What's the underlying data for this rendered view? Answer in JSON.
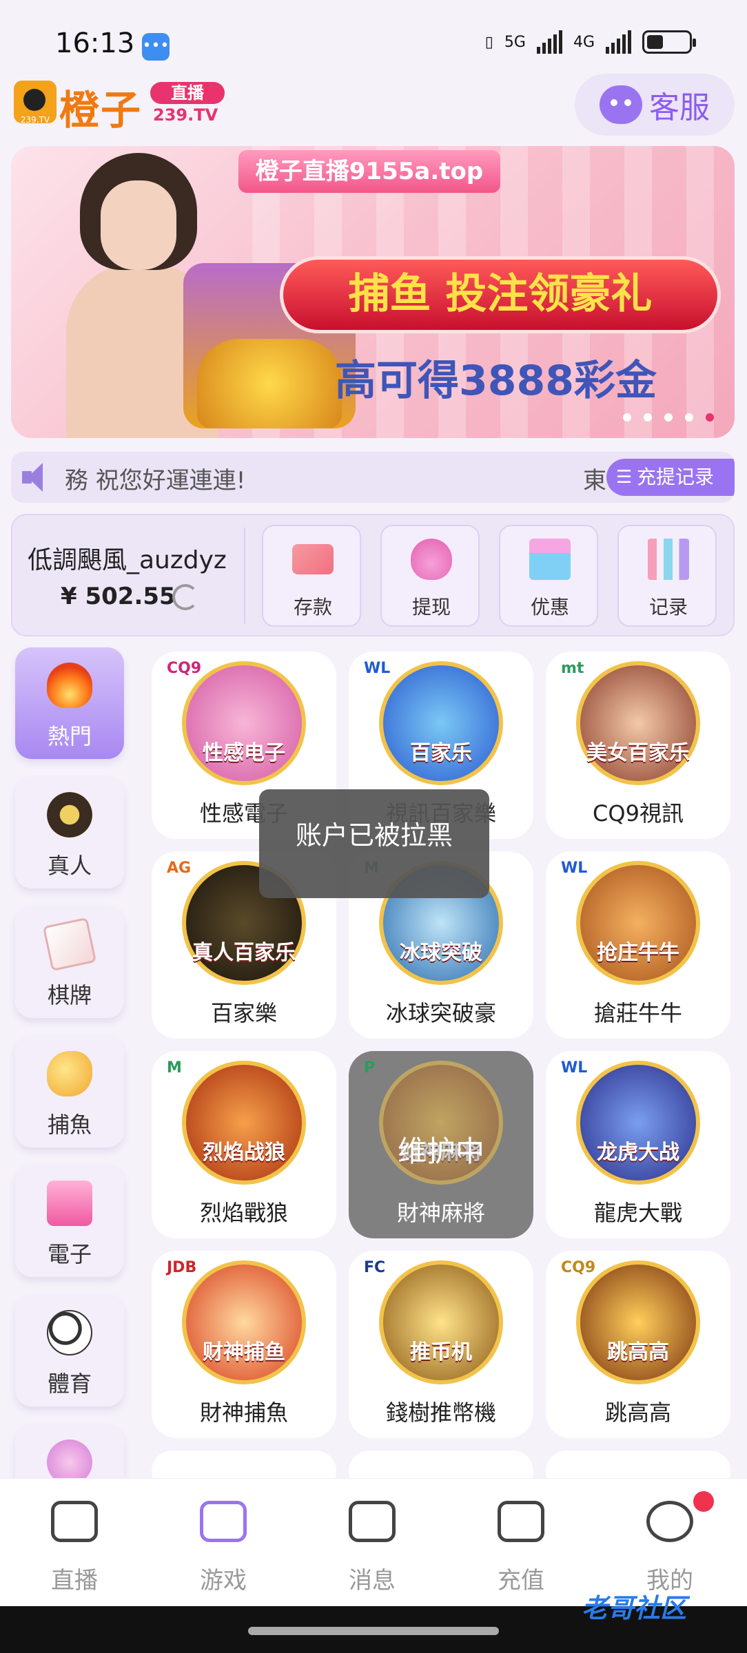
{
  "status_bar": {
    "time": "16:13",
    "network_1": "5G",
    "network_2": "4G",
    "battery_level": 0.4
  },
  "header": {
    "logo_text": "橙子",
    "logo_small": "239.TV",
    "live_badge": "直播",
    "domain": "239.TV",
    "service_label": "客服"
  },
  "banner": {
    "top_text": "橙子直播9155a.top",
    "main_text": "捕鱼 投注领豪礼",
    "sub_text": "高可得3888彩金",
    "slide_count": 5,
    "active_slide": 5
  },
  "marquee": {
    "text": "務 祝您好運連連!",
    "text_tail": "東",
    "record_button": "充提记录"
  },
  "account": {
    "username": "低調颶風_auzdyz",
    "balance": "¥ 502.55",
    "actions": [
      {
        "label": "存款",
        "icon": "deposit-card-icon"
      },
      {
        "label": "提现",
        "icon": "withdraw-bag-icon"
      },
      {
        "label": "优惠",
        "icon": "gift-icon"
      },
      {
        "label": "记录",
        "icon": "chart-icon"
      }
    ]
  },
  "categories": [
    {
      "label": "熱門",
      "icon": "fire-icon",
      "active": true
    },
    {
      "label": "真人",
      "icon": "chip-icon"
    },
    {
      "label": "棋牌",
      "icon": "card-icon"
    },
    {
      "label": "捕魚",
      "icon": "fish-icon"
    },
    {
      "label": "電子",
      "icon": "slot-icon"
    },
    {
      "label": "體育",
      "icon": "soccer-ball-icon"
    },
    {
      "label": "",
      "icon": "lottery-icon"
    }
  ],
  "games": [
    {
      "name": "性感電子",
      "brand": "CQ9",
      "tag": "性感电子"
    },
    {
      "name": "視訊百家樂",
      "brand": "WL",
      "tag": "百家乐"
    },
    {
      "name": "CQ9視訊",
      "brand": "mt",
      "tag": "美女百家乐"
    },
    {
      "name": "百家樂",
      "brand": "AG",
      "tag": "真人百家乐"
    },
    {
      "name": "冰球突破豪",
      "brand": "M",
      "tag": "冰球突破"
    },
    {
      "name": "搶莊牛牛",
      "brand": "WL",
      "tag": "抢庄牛牛"
    },
    {
      "name": "烈焰戰狼",
      "brand": "M",
      "tag": "烈焰战狼"
    },
    {
      "name": "財神麻將",
      "brand": "P",
      "tag": "财神麻将",
      "maintenance": "维护中"
    },
    {
      "name": "龍虎大戰",
      "brand": "WL",
      "tag": "龙虎大战"
    },
    {
      "name": "財神捕魚",
      "brand": "JDB",
      "tag": "财神捕鱼"
    },
    {
      "name": "錢樹推幣機",
      "brand": "FC",
      "tag": "推币机"
    },
    {
      "name": "跳高高",
      "brand": "CQ9",
      "tag": "跳高高"
    }
  ],
  "toast": {
    "text": "账户已被拉黑"
  },
  "bottom_nav": [
    {
      "label": "直播",
      "icon": "video-icon"
    },
    {
      "label": "游戏",
      "icon": "gamepad-icon"
    },
    {
      "label": "消息",
      "icon": "chat-icon"
    },
    {
      "label": "充值",
      "icon": "wallet-icon"
    },
    {
      "label": "我的",
      "icon": "profile-icon",
      "has_badge": true
    }
  ],
  "watermark": "老哥社区",
  "colors": {
    "accent": "#9a74f0",
    "brand_orange": "#f07a10",
    "live_pink": "#e8336c",
    "badge_red": "#f0334c"
  }
}
